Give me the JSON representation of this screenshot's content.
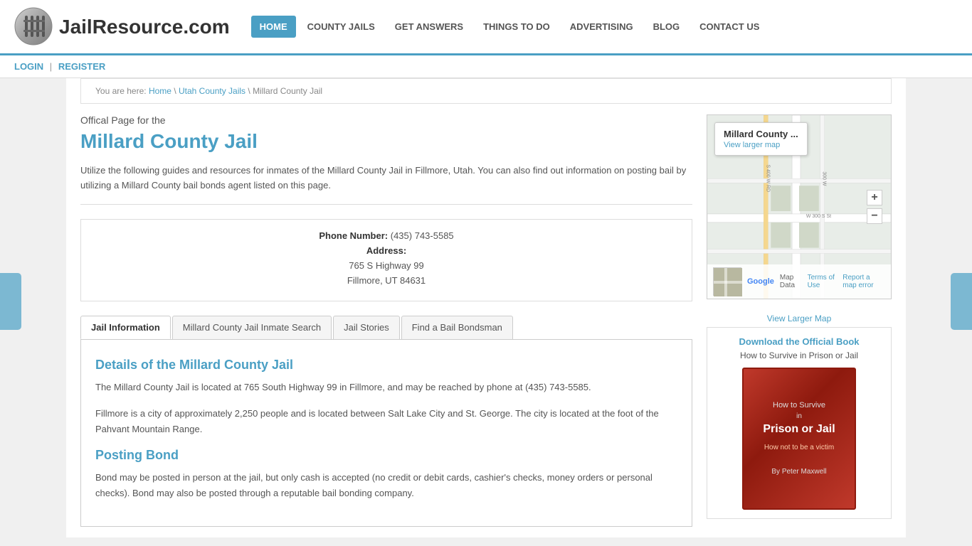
{
  "site": {
    "title": "JailResource.com"
  },
  "nav": {
    "items": [
      {
        "label": "HOME",
        "active": true
      },
      {
        "label": "COUNTY JAILS",
        "active": false
      },
      {
        "label": "GET ANSWERS",
        "active": false
      },
      {
        "label": "THINGS TO DO",
        "active": false
      },
      {
        "label": "ADVERTISING",
        "active": false
      },
      {
        "label": "BLOG",
        "active": false
      },
      {
        "label": "CONTACT US",
        "active": false
      }
    ]
  },
  "auth": {
    "login": "LOGIN",
    "separator": "|",
    "register": "REGISTER"
  },
  "breadcrumb": {
    "prefix": "You are here:",
    "home": "Home",
    "parent": "Utah County Jails",
    "current": "Millard County Jail"
  },
  "page": {
    "official_label": "Offical Page for the",
    "title": "Millard County Jail",
    "description": "Utilize the following guides and resources for inmates of the Millard County Jail in Fillmore, Utah. You can also find out information on posting bail by utilizing a Millard County bail bonds agent listed on this page."
  },
  "jail_info": {
    "phone_label": "Phone Number:",
    "phone": "(435) 743-5585",
    "address_label": "Address:",
    "street": "765 S Highway 99",
    "city_state_zip": "Fillmore, UT 84631"
  },
  "tabs": [
    {
      "label": "Jail Information",
      "active": true
    },
    {
      "label": "Millard County Jail Inmate Search",
      "active": false
    },
    {
      "label": "Jail Stories",
      "active": false
    },
    {
      "label": "Find a Bail Bondsman",
      "active": false
    }
  ],
  "tab_content": {
    "details_title": "Details of the Millard County Jail",
    "details_text1": "The Millard County Jail is located at 765 South Highway 99 in Fillmore, and may be reached by phone at (435) 743-5585.",
    "details_text2": "Fillmore is a city of approximately 2,250 people and is located between Salt Lake City and St. George. The city is located at the foot of the Pahvant Mountain Range.",
    "bond_title": "Posting Bond",
    "bond_text": "Bond may be posted in person at the jail, but only cash is accepted (no credit or debit cards, cashier's checks, money orders or personal checks). Bond may also be posted through a reputable bail bonding company."
  },
  "map": {
    "callout_title": "Millard County ...",
    "view_larger": "View larger map",
    "road1": "S 400 W RD",
    "road2": "W 300 S St",
    "zoom_in": "+",
    "zoom_out": "−",
    "footer_map_data": "Map Data",
    "footer_terms": "Terms of Use",
    "footer_report": "Report a map error",
    "view_larger_link": "View Larger Map"
  },
  "sidebar": {
    "book_link": "Download the Official Book",
    "book_subtitle": "How to Survive in Prison or Jail",
    "book_title_line1": "How to Survive",
    "book_title_line2": "in",
    "book_title_line3": "Prison or Jail",
    "book_tagline": "How not to be a victim",
    "book_author": "By Peter Maxwell"
  }
}
